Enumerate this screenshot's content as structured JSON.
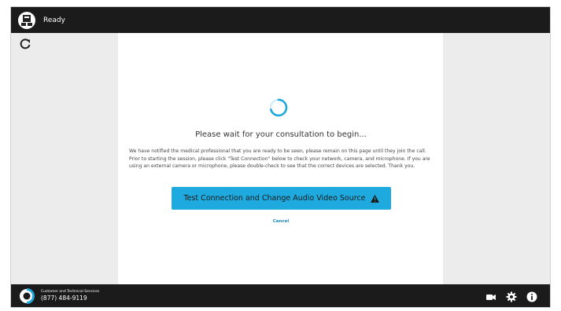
{
  "topbar": {
    "status": "Ready"
  },
  "content": {
    "title": "Please wait for your consultation to begin...",
    "notice": "We have notified the medical professional that you are ready to be seen, please remain on this page until they join the call. Prior to starting the session, please click \"Test Connection\" below to check your network, camera, and microphone. If you are using an external camera or microphone, please double-check to see that the correct devices are selected. Thank you.",
    "test_button_label": "Test Connection and Change Audio Video Source",
    "cancel_label": "Cancel"
  },
  "footer": {
    "support_label": "Customer and Technical Services",
    "support_phone": "(877) 484-9119"
  },
  "icons": {
    "refresh": "refresh-icon",
    "spinner": "loading-spinner",
    "warning": "warning-icon",
    "camera": "camera-icon",
    "settings": "gear-icon",
    "info": "info-icon"
  },
  "colors": {
    "accent": "#1eaadf",
    "bar": "#1b1b1b",
    "side": "#ececec",
    "link": "#1e8bc3"
  }
}
